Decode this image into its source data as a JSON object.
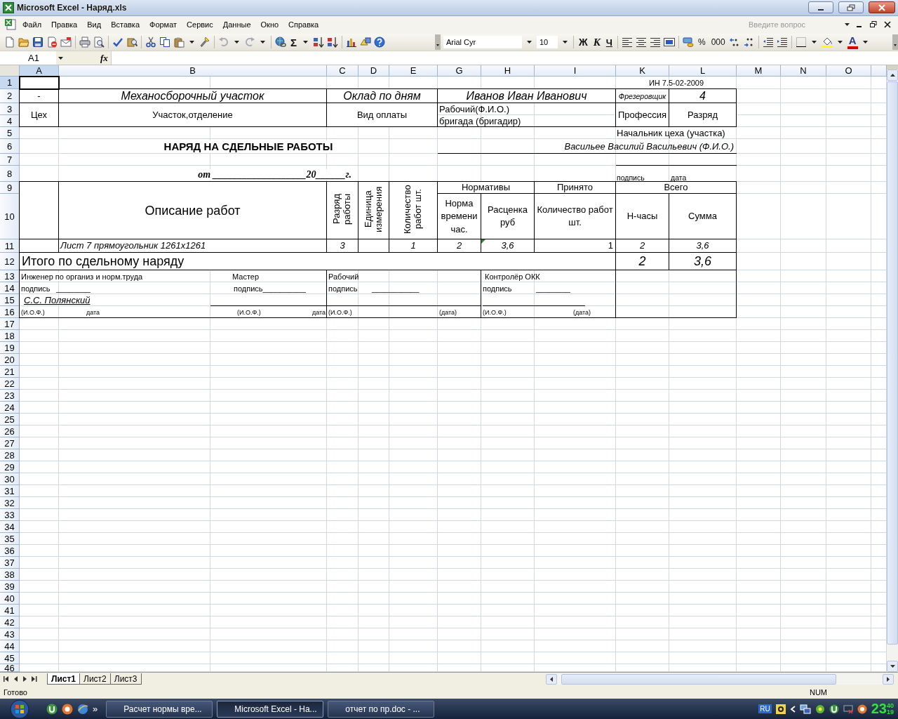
{
  "window": {
    "title": "Microsoft Excel - Наряд.xls"
  },
  "menu": [
    "Файл",
    "Правка",
    "Вид",
    "Вставка",
    "Формат",
    "Сервис",
    "Данные",
    "Окно",
    "Справка"
  ],
  "help_search": {
    "placeholder": "Введите вопрос"
  },
  "toolbar": {
    "sum_label": "Σ",
    "font_name": "Arial Cyr",
    "font_size": "10",
    "bold_label": "Ж",
    "italic_label": "К",
    "underline_label": "Ч",
    "percent_label": "%",
    "thousands_label": "000",
    "font_color_label": "A"
  },
  "formula_bar": {
    "name_box": "A1",
    "function_label": "fx"
  },
  "sheet": {
    "columns": [
      {
        "label": "A",
        "selected": true
      },
      {
        "label": "B",
        "selected": false
      },
      {
        "label": "C",
        "selected": false
      },
      {
        "label": "D",
        "selected": false
      },
      {
        "label": "E",
        "selected": false
      },
      {
        "label": "G",
        "selected": false
      },
      {
        "label": "H",
        "selected": false
      },
      {
        "label": "I",
        "selected": false
      },
      {
        "label": "K",
        "selected": false
      },
      {
        "label": "L",
        "selected": false
      },
      {
        "label": "M",
        "selected": false
      },
      {
        "label": "N",
        "selected": false
      },
      {
        "label": "O",
        "selected": false
      }
    ],
    "rows": [
      {
        "label": "1",
        "selected": true
      },
      {
        "label": "2",
        "selected": false
      },
      {
        "label": "3",
        "selected": false
      },
      {
        "label": "4",
        "selected": false
      },
      {
        "label": "5",
        "selected": false
      },
      {
        "label": "6",
        "selected": false
      },
      {
        "label": "7",
        "selected": false
      },
      {
        "label": "8",
        "selected": false
      },
      {
        "label": "9",
        "selected": false
      },
      {
        "label": "10",
        "selected": false
      },
      {
        "label": "11",
        "selected": false
      },
      {
        "label": "12",
        "selected": false
      },
      {
        "label": "13",
        "selected": false
      },
      {
        "label": "14",
        "selected": false
      },
      {
        "label": "15",
        "selected": false
      },
      {
        "label": "16",
        "selected": false
      },
      {
        "label": "17",
        "selected": false
      },
      {
        "label": "18",
        "selected": false
      },
      {
        "label": "19",
        "selected": false
      },
      {
        "label": "20",
        "selected": false
      },
      {
        "label": "21",
        "selected": false
      },
      {
        "label": "22",
        "selected": false
      },
      {
        "label": "23",
        "selected": false
      },
      {
        "label": "24",
        "selected": false
      },
      {
        "label": "25",
        "selected": false
      },
      {
        "label": "26",
        "selected": false
      },
      {
        "label": "27",
        "selected": false
      },
      {
        "label": "28",
        "selected": false
      },
      {
        "label": "29",
        "selected": false
      },
      {
        "label": "30",
        "selected": false
      },
      {
        "label": "31",
        "selected": false
      },
      {
        "label": "32",
        "selected": false
      },
      {
        "label": "33",
        "selected": false
      },
      {
        "label": "34",
        "selected": false
      },
      {
        "label": "35",
        "selected": false
      },
      {
        "label": "36",
        "selected": false
      },
      {
        "label": "37",
        "selected": false
      },
      {
        "label": "38",
        "selected": false
      },
      {
        "label": "39",
        "selected": false
      },
      {
        "label": "40",
        "selected": false
      },
      {
        "label": "41",
        "selected": false
      },
      {
        "label": "42",
        "selected": false
      },
      {
        "label": "43",
        "selected": false
      },
      {
        "label": "44",
        "selected": false
      },
      {
        "label": "45",
        "selected": false
      },
      {
        "label": "46",
        "selected": false
      }
    ],
    "cells": [
      {
        "text": "ИН 7.5-02-2009",
        "flag": false
      },
      {
        "text": "-",
        "flag": false
      },
      {
        "text": "Механосборочный участок",
        "flag": false
      },
      {
        "text": "Оклад по дням",
        "flag": false
      },
      {
        "text": "Иванов Иван Иванович",
        "flag": false
      },
      {
        "text": "Фрезеровщик",
        "flag": false
      },
      {
        "text": "4",
        "flag": false
      },
      {
        "text": "Цех",
        "flag": false
      },
      {
        "text": "Участок,отделение",
        "flag": false
      },
      {
        "text": "Вид оплаты",
        "flag": false
      },
      {
        "text": "Рабочий(Ф.И.О.)",
        "flag": false
      },
      {
        "text": "бригада (бригадир)",
        "flag": false
      },
      {
        "text": "Профессия",
        "flag": false
      },
      {
        "text": "Разряд",
        "flag": false
      },
      {
        "text": "Начальник цеха (участка)",
        "flag": false
      },
      {
        "text": "НАРЯД НА СДЕЛЬНЫЕ РАБОТЫ",
        "flag": false
      },
      {
        "text": "Васильее Василий Васильевич (Ф.И.О.)",
        "flag": false
      },
      {
        "text": "от ___________________20______г.",
        "flag": false
      },
      {
        "text": "подпись",
        "flag": false
      },
      {
        "text": "дата",
        "flag": false
      },
      {
        "text": "Описание работ",
        "flag": false
      },
      {
        "text": "Разряд работы",
        "flag": false
      },
      {
        "text": "Единица измерения",
        "flag": false
      },
      {
        "text": "Количество работ шт.",
        "flag": false
      },
      {
        "text": "Нормативы",
        "flag": false
      },
      {
        "text": "Принято",
        "flag": false
      },
      {
        "text": "Всего",
        "flag": false
      },
      {
        "text": "Норма времени час.",
        "flag": false
      },
      {
        "text": "Расценка руб",
        "flag": false
      },
      {
        "text": "Количество работ шт.",
        "flag": false
      },
      {
        "text": "Н-часы",
        "flag": false
      },
      {
        "text": "Сумма",
        "flag": false
      },
      {
        "text": "Лист 7 прямоугольник 1261x1261",
        "flag": false
      },
      {
        "text": "3",
        "flag": false
      },
      {
        "text": "1",
        "flag": false
      },
      {
        "text": "2",
        "flag": false
      },
      {
        "text": "3,6",
        "flag": true
      },
      {
        "text": "1",
        "flag": false
      },
      {
        "text": "2",
        "flag": false
      },
      {
        "text": "3,6",
        "flag": false
      },
      {
        "text": "Итого по сдельному наряду",
        "flag": false
      },
      {
        "text": "2",
        "flag": false
      },
      {
        "text": "3,6",
        "flag": false
      },
      {
        "text": "Инженер по организ и норм.труда",
        "flag": false
      },
      {
        "text": "Мастер",
        "flag": false
      },
      {
        "text": "Рабочий",
        "flag": false
      },
      {
        "text": "Контролёр ОКК",
        "flag": false
      },
      {
        "text": "подпись",
        "flag": false
      },
      {
        "text": "________",
        "flag": false
      },
      {
        "text": "подпись__________",
        "flag": false
      },
      {
        "text": "подпись",
        "flag": false
      },
      {
        "text": "___________",
        "flag": false
      },
      {
        "text": "подпись",
        "flag": false
      },
      {
        "text": "________",
        "flag": false
      },
      {
        "text": "С.С. Полянский",
        "flag": false
      },
      {
        "text": "(И.О.Ф.)",
        "flag": false
      },
      {
        "text": "дата",
        "flag": false
      },
      {
        "text": "(И.О.Ф.)",
        "flag": false
      },
      {
        "text": "дата",
        "flag": false
      },
      {
        "text": "(И.О.Ф.)",
        "flag": false
      },
      {
        "text": "(дата)",
        "flag": false
      },
      {
        "text": "(И.О.Ф.)",
        "flag": false
      },
      {
        "text": "(дата)",
        "flag": false
      }
    ]
  },
  "sheet_tabs": [
    {
      "label": "Лист1",
      "selected": true
    },
    {
      "label": "Лист2",
      "selected": false
    },
    {
      "label": "Лист3",
      "selected": false
    }
  ],
  "status_bar": {
    "left": "Готово",
    "right": "NUM"
  },
  "taskbar": {
    "quick_launch_more": "»",
    "tasks": [
      {
        "label": "Расчет нормы вре...",
        "selected": false
      },
      {
        "label": "Microsoft Excel - На...",
        "selected": true
      },
      {
        "label": "отчет по пр.doc - ...",
        "selected": false
      }
    ],
    "language": "RU",
    "clock": [
      "23",
      "40",
      "19"
    ]
  }
}
